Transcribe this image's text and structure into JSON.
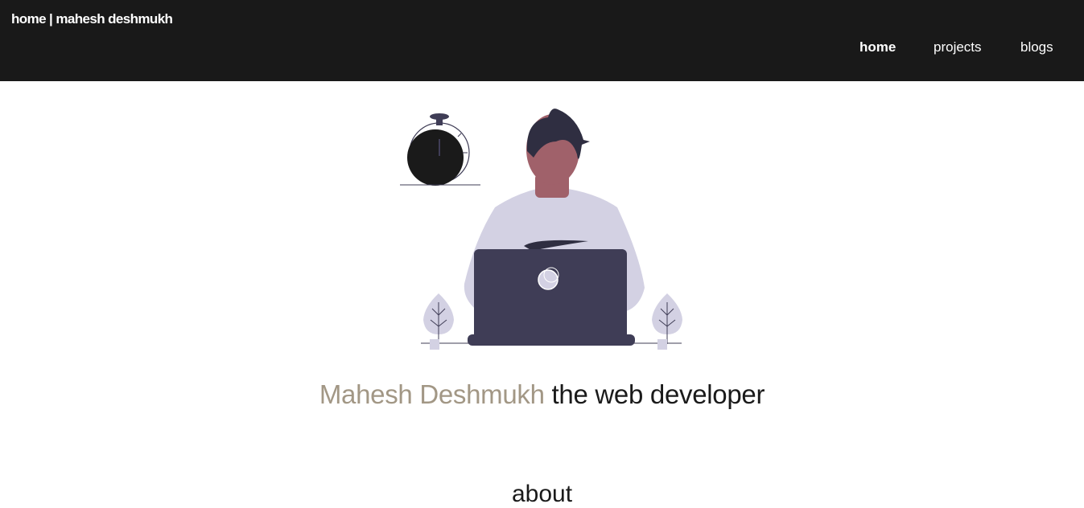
{
  "header": {
    "brand": "home | mahesh deshmukh",
    "nav": [
      {
        "label": "home",
        "active": true
      },
      {
        "label": "projects",
        "active": false
      },
      {
        "label": "blogs",
        "active": false
      }
    ]
  },
  "hero": {
    "illustration": {
      "icons": [
        "stopwatch-icon",
        "person-with-laptop-illustration",
        "plant-icon",
        "plant-icon"
      ],
      "colors": {
        "dark": "#3f3d56",
        "shirt": "#d3d1e3",
        "skin": "#a0616a",
        "hair": "#2f2e41",
        "watch": "#1a1a1a"
      }
    },
    "name": "Mahesh Deshmukh",
    "tagline": " the web developer",
    "name_color": "#a29785"
  },
  "next_section": {
    "heading_peek": "about"
  }
}
